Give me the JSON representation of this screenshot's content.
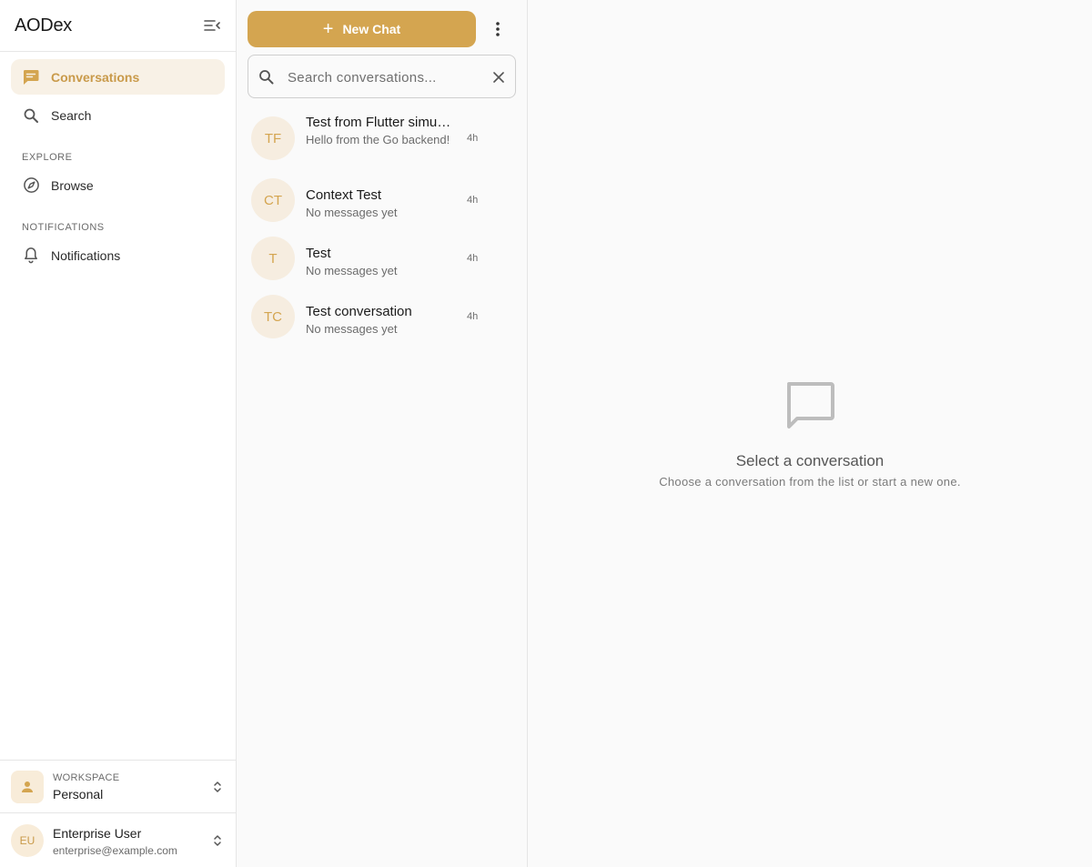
{
  "colors": {
    "accent": "#d4a550",
    "accent_text": "#c99a4a",
    "active_bg": "#f8f1e6",
    "avatar_bg": "#f6ede0"
  },
  "sidebar": {
    "app_title": "AODex",
    "collapse_icon": "menu-collapse-icon",
    "nav": [
      {
        "label": "Conversations",
        "icon": "chat-bubble-icon",
        "active": true
      },
      {
        "label": "Search",
        "icon": "search-icon",
        "active": false
      }
    ],
    "explore": {
      "section_label": "EXPLORE",
      "items": [
        {
          "label": "Browse",
          "icon": "compass-icon"
        }
      ]
    },
    "notifications": {
      "section_label": "NOTIFICATIONS",
      "items": [
        {
          "label": "Notifications",
          "icon": "bell-icon"
        }
      ]
    },
    "workspace": {
      "caption": "WORKSPACE",
      "name": "Personal",
      "icon": "person-icon"
    },
    "user": {
      "initials": "EU",
      "name": "Enterprise User",
      "email": "enterprise@example.com"
    }
  },
  "list": {
    "new_chat_label": "New Chat",
    "search_placeholder": "Search conversations...",
    "search_value": "",
    "conversations": [
      {
        "initials": "TF",
        "title": "Test from Flutter simulator",
        "preview": "Hello from the Go backend!",
        "time": "4h"
      },
      {
        "initials": "CT",
        "title": "Context Test",
        "preview": "No messages yet",
        "time": "4h"
      },
      {
        "initials": "T",
        "title": "Test",
        "preview": "No messages yet",
        "time": "4h"
      },
      {
        "initials": "TC",
        "title": "Test conversation",
        "preview": "No messages yet",
        "time": "4h"
      }
    ]
  },
  "empty_state": {
    "icon": "message-square-icon",
    "title": "Select a conversation",
    "subtitle": "Choose a conversation from the list or start a new one."
  }
}
